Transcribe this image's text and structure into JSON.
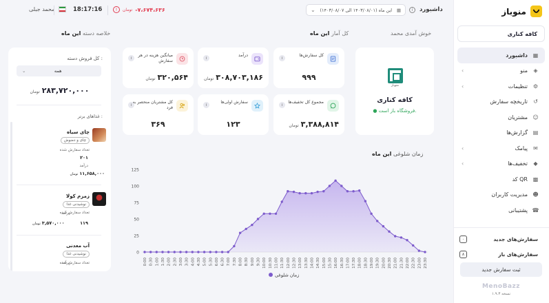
{
  "topbar": {
    "user_name": "محمد جبلی",
    "time": "18:17:16",
    "balance_currency": "تومان",
    "balance_amount": "-۷،۶۷۴،۶۳۶",
    "date_range": "این ماه (۱۴۰۳/۰۸/۰۱ الی ۱۴۰۳/۰۸/۰۷)",
    "page_title": "داشبورد"
  },
  "sidebar": {
    "brand": "منوباز",
    "cafe": "کافه کناری",
    "items": [
      {
        "label": "داشبورد",
        "icon": "grid-icon",
        "chevron": false,
        "active": true
      },
      {
        "label": "منو",
        "icon": "layers-icon",
        "chevron": true
      },
      {
        "label": "تنظیمات",
        "icon": "gear-icon",
        "chevron": true
      },
      {
        "label": "تاریخچه سفارش",
        "icon": "history-icon",
        "chevron": false
      },
      {
        "label": "مشتریان",
        "icon": "users-icon",
        "chevron": false
      },
      {
        "label": "گزارش‌ها",
        "icon": "report-icon",
        "chevron": false
      },
      {
        "label": "پیامک",
        "icon": "sms-icon",
        "chevron": true
      },
      {
        "label": "تخفیف‌ها",
        "icon": "tag-icon",
        "chevron": true
      },
      {
        "label": "کد QR",
        "icon": "qr-icon",
        "chevron": false
      },
      {
        "label": "مدیریت کاربران",
        "icon": "user-manage-icon",
        "chevron": false
      },
      {
        "label": "پشتیبانی",
        "icon": "support-icon",
        "chevron": false
      }
    ],
    "new_orders_label": "سفارش‌های جدید",
    "new_orders_count": "۰",
    "open_orders_label": "سفارش‌های باز",
    "open_orders_count": "۸",
    "register_button": "ثبت سفارش جدید",
    "footer_brand": "MenoBazz",
    "version": "نسخه ۱.۹.۳"
  },
  "headings": {
    "welcome": "خوش آمدی محمد",
    "stats_prefix": "کل آمار",
    "stats_period": "این ماه",
    "category_prefix": "خلاصه دسته",
    "category_period": "این ماه"
  },
  "restaurant": {
    "logo_text": "منوباز",
    "name": "کافه کناری",
    "status": "فروشگاه باز است."
  },
  "stats": {
    "orders": {
      "label": "کل سفارش‌ها",
      "value": "۹۹۹"
    },
    "revenue": {
      "label": "درآمد",
      "value": "۳۰۸,۷۰۳,۱۸۶",
      "unit": "تومان"
    },
    "avg_cost": {
      "label": "میانگین هزینه در هر سفارش",
      "value": "۳۲۰,۵۶۴",
      "unit": "تومان"
    },
    "discounts": {
      "label": "مجموع کل تخفیف‌ها",
      "value": "۳,۳۸۸,۸۱۴",
      "unit": "تومان"
    },
    "first_orders": {
      "label": "سفارش اولی‌ها",
      "value": "۱۲۳"
    },
    "unique_customers": {
      "label": "کل مشتریان منحصر به فرد",
      "value": "۳۶۹"
    }
  },
  "chart_data": {
    "type": "area",
    "title_prefix": "زمان شلوغی",
    "title_period": "این ماه",
    "x": [
      "0:00",
      "1:00",
      "2:00",
      "3:00",
      "4:00",
      "5:00",
      "6:00",
      "7:00",
      "8:00",
      "9:00",
      "10:00",
      "11:00",
      "12:00",
      "13:00",
      "14:00",
      "15:00",
      "16:00",
      "17:00",
      "18:00",
      "19:00",
      "20:00",
      "21:00",
      "22:00",
      "23:00"
    ],
    "x_ticks": [
      "0:00",
      "0:30",
      "1:00",
      "1:30",
      "2:00",
      "2:30",
      "3:00",
      "3:30",
      "4:00",
      "4:30",
      "5:00",
      "5:30",
      "6:00",
      "6:30",
      "7:00",
      "7:30",
      "8:00",
      "8:30",
      "9:00",
      "9:30",
      "10:00",
      "10:30",
      "11:00",
      "11:30",
      "12:00",
      "12:30",
      "13:00",
      "13:30",
      "14:00",
      "14:30",
      "15:00",
      "15:30",
      "16:00",
      "16:30",
      "17:00",
      "17:30",
      "18:00",
      "18:30",
      "19:00",
      "19:30",
      "20:00",
      "20:30",
      "21:00",
      "21:30",
      "22:00",
      "22:30",
      "23:00",
      "23:30"
    ],
    "series": [
      {
        "name": "زمان شلوغی",
        "points": [
          [
            0,
            0
          ],
          [
            0.5,
            0
          ],
          [
            1,
            0
          ],
          [
            1.5,
            0
          ],
          [
            2,
            0
          ],
          [
            2.5,
            0
          ],
          [
            3,
            0
          ],
          [
            3.5,
            0
          ],
          [
            4,
            0
          ],
          [
            4.5,
            0
          ],
          [
            5,
            0
          ],
          [
            5.5,
            0
          ],
          [
            6,
            0
          ],
          [
            6.5,
            0
          ],
          [
            7,
            0
          ],
          [
            7.5,
            9
          ],
          [
            8,
            29
          ],
          [
            8.5,
            35
          ],
          [
            9,
            41
          ],
          [
            9.5,
            50
          ],
          [
            10,
            58
          ],
          [
            10.5,
            58
          ],
          [
            11,
            58
          ],
          [
            11.5,
            76
          ],
          [
            12,
            92
          ],
          [
            12.5,
            91
          ],
          [
            13,
            89
          ],
          [
            13.5,
            89
          ],
          [
            14,
            89
          ],
          [
            14.5,
            91
          ],
          [
            15,
            92
          ],
          [
            15.5,
            100
          ],
          [
            16,
            108
          ],
          [
            16.5,
            100
          ],
          [
            17,
            92
          ],
          [
            17.5,
            92
          ],
          [
            18,
            93
          ],
          [
            18.5,
            77
          ],
          [
            19,
            58
          ],
          [
            19.5,
            47
          ],
          [
            20,
            39
          ],
          [
            20.5,
            31
          ],
          [
            21,
            24
          ],
          [
            21.5,
            22
          ],
          [
            22,
            18
          ],
          [
            22.5,
            10
          ],
          [
            23,
            2
          ],
          [
            23.5,
            0
          ]
        ]
      }
    ],
    "y_ticks": [
      "0",
      "25",
      "50",
      "75",
      "100",
      "125"
    ],
    "ylim": [
      0,
      125
    ],
    "legend_position": "bottom-center",
    "line_color": "#7d5ccc",
    "fill_color": "#c4b3ee",
    "grid": false
  },
  "category_summary": {
    "title": "کل فروش دسته :",
    "select_value": "همه",
    "total": "۲۸۳,۷۲۰,۰۰۰",
    "unit": "تومان",
    "top_foods_title": "غذاهای برتر :",
    "foods": [
      {
        "name": "چای سیاه",
        "category": "چای و دمنوش",
        "count_label": "تعداد سفارش شده",
        "count": "۲۰۱",
        "revenue_label": "درآمد",
        "revenue": "۱۱,۶۵۸,۰۰۰",
        "unit": "تومان"
      },
      {
        "name": "زمزم کولا",
        "category": "نوشیدنی غذا",
        "count_label": "تعداد سفارش شده",
        "count": "۱۱۹",
        "revenue_label": "درآمد",
        "revenue": "۳,۵۷۰,۰۰۰",
        "unit": "تومان"
      },
      {
        "name": "آب معدنی",
        "category": "نوشیدنی غذا",
        "count_label": "تعداد سفارش شده",
        "revenue_label": "درآمد"
      }
    ]
  },
  "colors": {
    "accent_yellow": "#f4c518",
    "negative_red": "#e23b4f",
    "open_green": "#2fa55a",
    "chart_purple": "#7d5ccc"
  }
}
